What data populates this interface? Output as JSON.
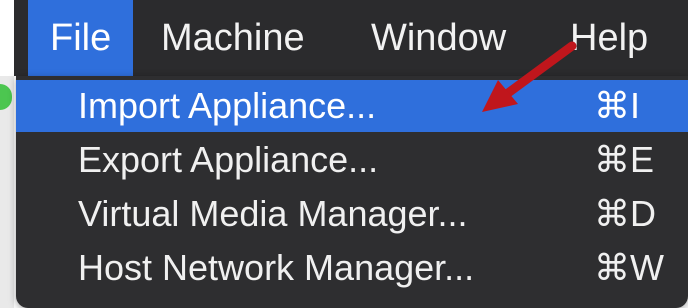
{
  "menubar": {
    "items": [
      {
        "label": "File",
        "active": true
      },
      {
        "label": "Machine",
        "active": false
      },
      {
        "label": "Window",
        "active": false
      },
      {
        "label": "Help",
        "active": false
      }
    ]
  },
  "file_menu": {
    "items": [
      {
        "label": "Import Appliance...",
        "shortcut": "⌘I",
        "highlighted": true
      },
      {
        "label": "Export Appliance...",
        "shortcut": "⌘E",
        "highlighted": false
      },
      {
        "label": "Virtual Media Manager...",
        "shortcut": "⌘D",
        "highlighted": false
      },
      {
        "label": "Host Network Manager...",
        "shortcut": "⌘W",
        "highlighted": false
      }
    ]
  },
  "annotation": {
    "arrow_icon": "red-arrow-icon",
    "arrow_color": "#c0161c"
  },
  "colors": {
    "menu_background": "#2e2e30",
    "highlight": "#2f6fdc",
    "text": "#f0f0f0"
  }
}
